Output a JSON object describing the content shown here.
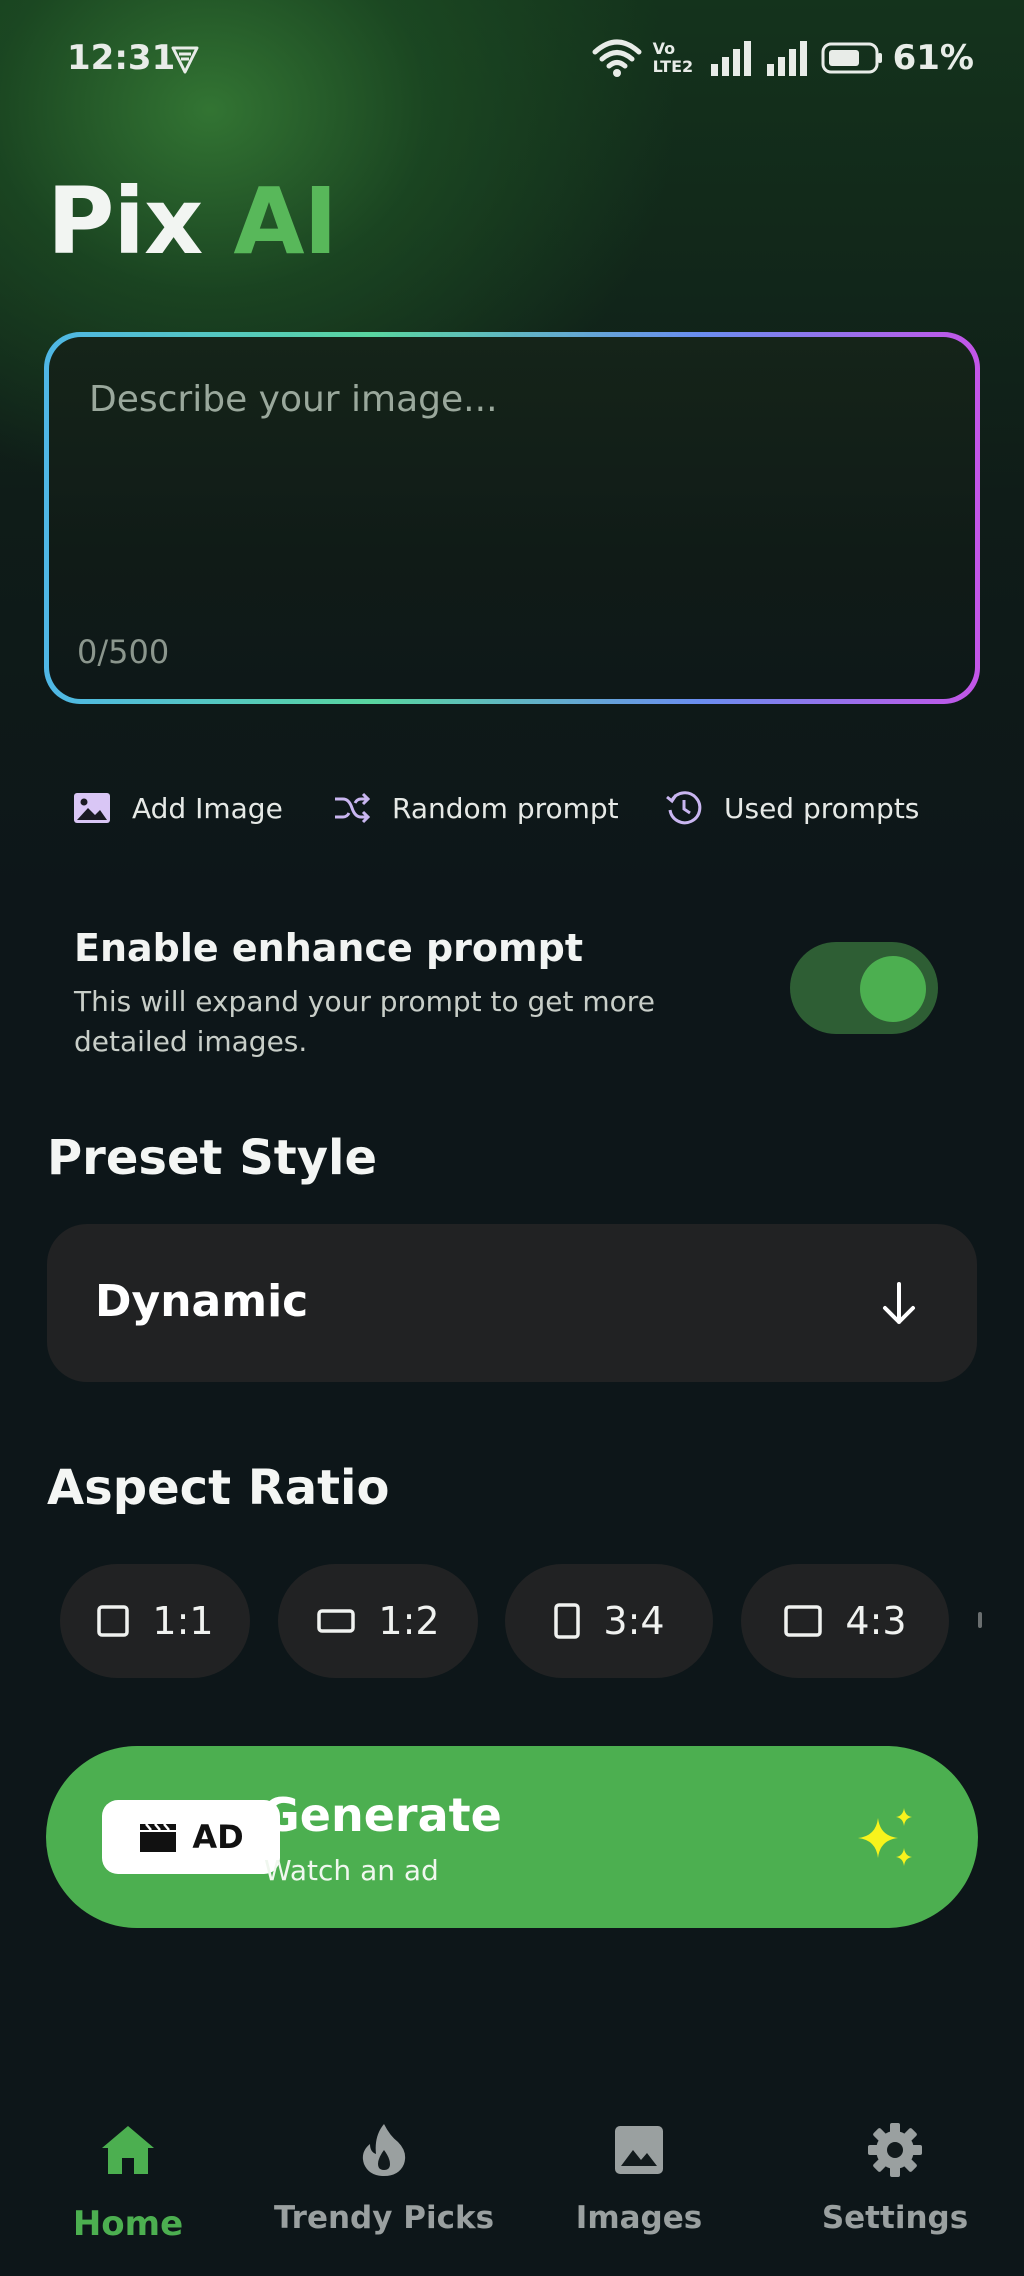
{
  "status_bar": {
    "time": "12:31",
    "volte_line1": "Vo",
    "volte_line2": "LTE2",
    "battery": "61%"
  },
  "app": {
    "title_part1": "Pix",
    "title_part2": "AI",
    "brand_color": "#4caf50"
  },
  "prompt": {
    "placeholder": "Describe your image...",
    "value": "",
    "char_count": "0/500"
  },
  "actions": [
    {
      "label": "Add Image",
      "icon": "image-icon"
    },
    {
      "label": "Random prompt",
      "icon": "shuffle-icon"
    },
    {
      "label": "Used prompts",
      "icon": "history-icon"
    }
  ],
  "enhance": {
    "title": "Enable enhance prompt",
    "description": "This will expand your prompt to get more detailed images.",
    "enabled": true
  },
  "preset_style": {
    "heading": "Preset Style",
    "selected": "Dynamic"
  },
  "aspect_ratio": {
    "heading": "Aspect Ratio",
    "options": [
      "1:1",
      "1:2",
      "3:4",
      "4:3"
    ]
  },
  "generate": {
    "badge": "AD",
    "title": "Generate",
    "subtitle": "Watch an ad"
  },
  "nav": {
    "items": [
      {
        "label": "Home",
        "icon": "home-icon",
        "active": true
      },
      {
        "label": "Trendy Picks",
        "icon": "flame-icon",
        "active": false
      },
      {
        "label": "Images",
        "icon": "image-icon",
        "active": false
      },
      {
        "label": "Settings",
        "icon": "gear-icon",
        "active": false
      }
    ]
  }
}
